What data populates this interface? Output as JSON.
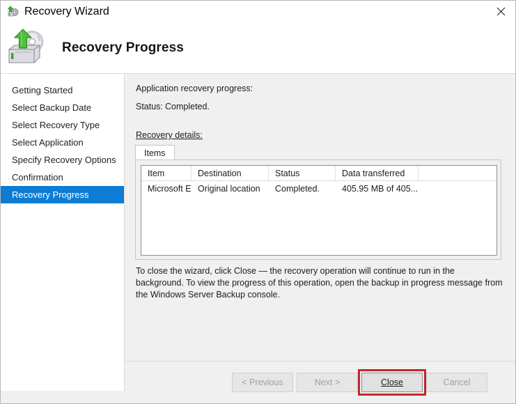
{
  "window": {
    "title": "Recovery Wizard",
    "title_icon": "recovery-wizard-icon",
    "close_icon": "close-icon"
  },
  "header": {
    "title": "Recovery Progress",
    "icon": "disk-drive-restore-icon"
  },
  "sidebar": {
    "items": [
      {
        "label": "Getting Started",
        "selected": false
      },
      {
        "label": "Select Backup Date",
        "selected": false
      },
      {
        "label": "Select Recovery Type",
        "selected": false
      },
      {
        "label": "Select Application",
        "selected": false
      },
      {
        "label": "Specify Recovery Options",
        "selected": false
      },
      {
        "label": "Confirmation",
        "selected": false
      },
      {
        "label": "Recovery Progress",
        "selected": true
      }
    ],
    "selected_color": "#0c7cd5"
  },
  "main": {
    "progress_caption": "Application recovery progress:",
    "status_label": "Status:",
    "status_value": "Completed.",
    "details_label": "Recovery details:",
    "tabs": [
      {
        "label": "Items",
        "active": true
      }
    ],
    "table": {
      "columns": [
        "Item",
        "Destination",
        "Status",
        "Data transferred"
      ],
      "rows": [
        [
          "Microsoft E...",
          "Original location",
          "Completed.",
          "405.95 MB of 405...."
        ]
      ]
    },
    "note_line1": "To close the wizard, click Close — the recovery operation will continue to run in the background.",
    "note_line2": "To view the progress of this operation, open the backup in progress message from the Windows",
    "note_line3": "Server Backup console."
  },
  "buttons": {
    "previous": {
      "label": "< Previous",
      "enabled": false
    },
    "next": {
      "label": "Next >",
      "enabled": false
    },
    "close": {
      "label": "Close",
      "enabled": true
    },
    "cancel": {
      "label": "Cancel",
      "enabled": false
    }
  },
  "annotation": {
    "highlight_target": "close-button",
    "highlight_color": "#c0282d"
  }
}
